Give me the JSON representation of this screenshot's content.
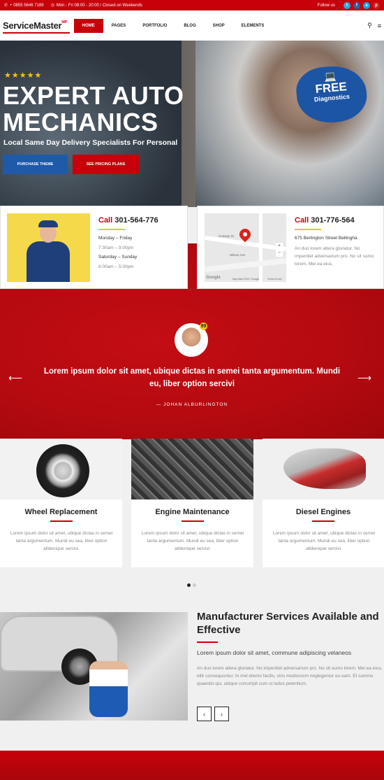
{
  "topbar": {
    "phone": "+ 0855 5646 7189",
    "hours": "Mon - Fri 08:00 - 20:00 / Closed on Weekends",
    "follow": "Follow us"
  },
  "nav": {
    "logo": "ServiceMaster",
    "logo_sup": "WP",
    "items": [
      "HOME",
      "PAGES",
      "PORTFOLIO",
      "BLOG",
      "SHOP",
      "ELEMENTS"
    ]
  },
  "hero": {
    "stars": "★★★★★",
    "title_line1": "EXPERT AUTO",
    "title_line2": "MECHANICS",
    "subtitle": "Local Same Day Delivery Specialists For Personal",
    "btn_primary": "PURCHASE THEME",
    "btn_secondary": "SEE PRICING PLANS",
    "badge_free": "FREE",
    "badge_diag": "Diagnostics"
  },
  "contact1": {
    "call_word": "Call",
    "phone": "301-564-776",
    "weekday_label": "Monday – Friday",
    "weekday_hours": "7:30am – 9:00pm",
    "weekend_label": "Saturday – Sunday",
    "weekend_hours": "8:00am – 5:00pm"
  },
  "contact2": {
    "call_word": "Call",
    "phone": "301-776-564",
    "address": "675 Berlington Street Bellingha",
    "desc": "An duo lorem altera gloriatur. No imperdiet adversarium pro. No sit sumo lorem. Mei ea eius.",
    "map_labels": [
      "Conway St",
      "Wilson Ave",
      "Map data ©2017 Google",
      "Terms of Use",
      "Google"
    ]
  },
  "testimonial": {
    "quote": "Lorem ipsum dolor sit amet, ubique dictas in semei tanta argumentum. Mundi eu, liber option sercivi",
    "author": "— JOHAN ALBURLINGTON",
    "badge": "99"
  },
  "services": [
    {
      "title": "Wheel Replacement",
      "desc": "Lorem ipsum dolor sit amet, ubique dictas in semei tanta argumentum. Mundi eu sea, liber option alldenique sercivi."
    },
    {
      "title": "Engine Maintenance",
      "desc": "Lorem ipsum dolor sit amet, ubique dictas in semei tanta argumentum. Mundi eu sea, liber option alldenique sercivi."
    },
    {
      "title": "Diesel Engines",
      "desc": "Lorem ipsum dolor sit amet, ubique dictas in semei tanta argumentum. Mundi eu sea, liber option alldenique sercivi."
    }
  ],
  "about": {
    "title": "Manufacturer Services Available and Effective",
    "subtitle": "Lorem ipsum dolor sit amet, commune adipiscing velaneos",
    "body": "An duo lorem altera gloriatur. No imperdiet adversarium pro. No sit sumo lorem. Mei ea eius, elitr consequuntur. In mel eterno facilis, viris mediocrem neglegentur eu eam. Et summo quaestio qui, ubique corrumpit cum ut ludus petentium."
  },
  "colors": {
    "accent": "#c8000a",
    "blue": "#1f5aa8",
    "star": "#f6c31c"
  }
}
